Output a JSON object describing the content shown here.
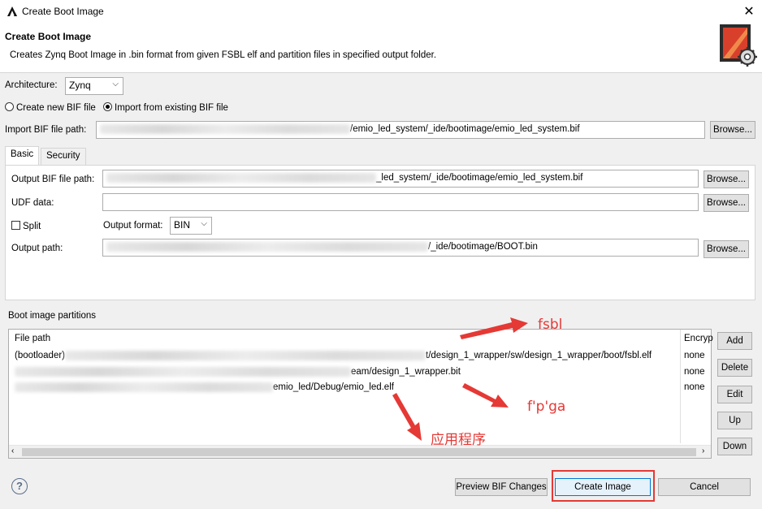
{
  "window": {
    "title": "Create Boot Image",
    "close_glyph": "✕"
  },
  "header": {
    "title": "Create Boot Image",
    "description": "Creates Zynq Boot Image in .bin format from given FSBL elf and partition files in specified output folder."
  },
  "architecture": {
    "label": "Architecture:",
    "value": "Zynq"
  },
  "bif_mode": {
    "create_label": "Create new BIF file",
    "import_label": "Import from existing BIF file",
    "selected": "import"
  },
  "import_bif": {
    "label": "Import BIF file path:",
    "value_visible": "/emio_led_system/_ide/bootimage/emio_led_system.bif",
    "browse": "Browse..."
  },
  "tabs": [
    {
      "label": "Basic",
      "active": true
    },
    {
      "label": "Security",
      "active": false
    }
  ],
  "basic": {
    "output_bif": {
      "label": "Output BIF file path:",
      "value_visible": "_led_system/_ide/bootimage/emio_led_system.bif",
      "browse": "Browse..."
    },
    "udf": {
      "label": "UDF data:",
      "value": "",
      "browse": "Browse..."
    },
    "split": {
      "label": "Split",
      "checked": false
    },
    "output_format": {
      "label": "Output format:",
      "value": "BIN"
    },
    "output_path": {
      "label": "Output path:",
      "value_visible": "/_ide/bootimage/BOOT.bin",
      "browse": "Browse..."
    }
  },
  "partitions": {
    "section_label": "Boot image partitions",
    "columns": [
      "File path",
      "Encryp"
    ],
    "rows": [
      {
        "prefix": "(bootloader)",
        "path_visible": "t/design_1_wrapper/sw/design_1_wrapper/boot/fsbl.elf",
        "encryption": "none"
      },
      {
        "prefix": "",
        "path_visible": "eam/design_1_wrapper.bit",
        "encryption": "none"
      },
      {
        "prefix": "",
        "path_visible": "emio_led/Debug/emio_led.elf",
        "encryption": "none"
      }
    ],
    "buttons": {
      "add": "Add",
      "delete": "Delete",
      "edit": "Edit",
      "up": "Up",
      "down": "Down"
    }
  },
  "annotations": {
    "fsbl": "fsbl",
    "fpga": "f'p'ga",
    "app": "应用程序"
  },
  "footer": {
    "help": "?",
    "preview": "Preview BIF Changes",
    "create": "Create Image",
    "cancel": "Cancel"
  },
  "colors": {
    "annotation_red": "#e53935",
    "focus_blue": "#0078d7"
  }
}
